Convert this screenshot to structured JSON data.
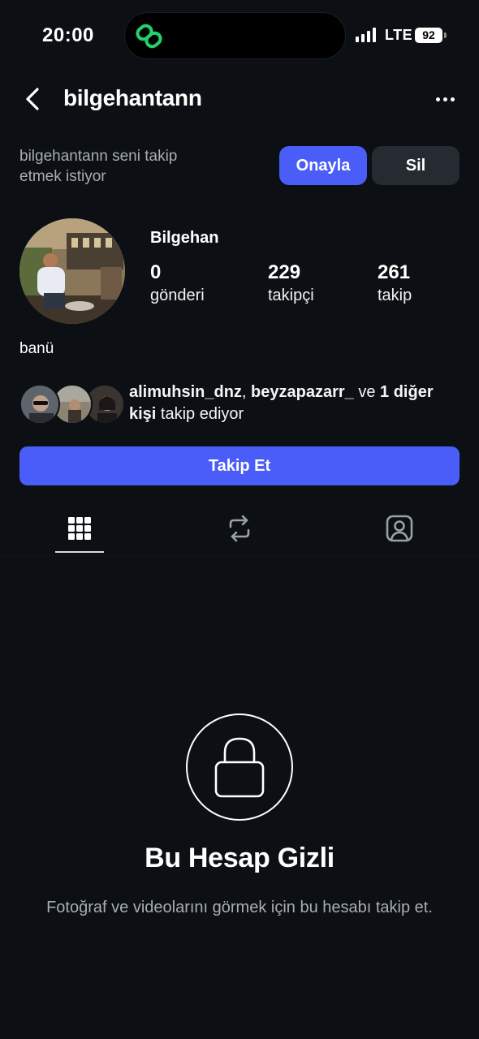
{
  "status_bar": {
    "time": "20:00",
    "network": "LTE",
    "battery": "92"
  },
  "header": {
    "username": "bilgehantann",
    "back_icon": "chevron-left-icon",
    "more_icon": "more-horizontal-icon"
  },
  "follow_request": {
    "text": "bilgehantann seni takip etmek istiyor",
    "approve_label": "Onayla",
    "delete_label": "Sil"
  },
  "profile": {
    "display_name": "Bilgehan",
    "stats": [
      {
        "value": "0",
        "label": "gönderi"
      },
      {
        "value": "229",
        "label": "takipçi"
      },
      {
        "value": "261",
        "label": "takip"
      }
    ],
    "bio": "banü"
  },
  "mutual_followers": {
    "user1": "alimuhsin_dnz",
    "separator": ",",
    "user2": "beyzapazarr_",
    "conjunction": "ve",
    "others": "1 diğer kişi",
    "suffix": "takip ediyor"
  },
  "actions": {
    "follow_label": "Takip Et"
  },
  "tabs": [
    {
      "icon": "grid-icon",
      "active": true
    },
    {
      "icon": "repost-icon",
      "active": false
    },
    {
      "icon": "tagged-person-icon",
      "active": false
    }
  ],
  "private_account": {
    "icon": "lock-icon",
    "title": "Bu Hesap Gizli",
    "description": "Fotoğraf ve videolarını görmek için bu hesabı takip et."
  },
  "colors": {
    "background": "#0c1014",
    "accent": "#4a5df9",
    "secondary_button": "#262a31",
    "muted_text": "#a8adb5"
  }
}
